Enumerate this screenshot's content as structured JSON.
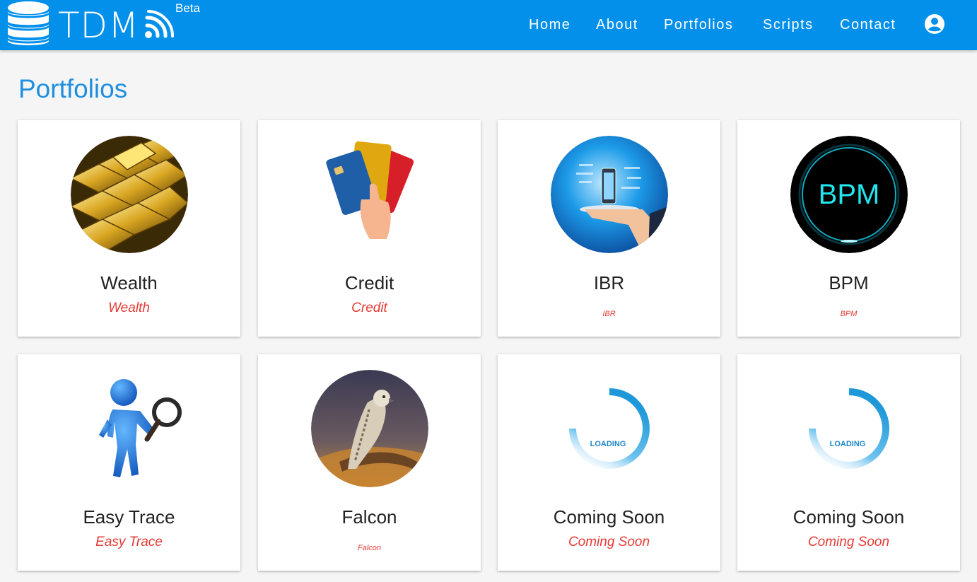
{
  "header": {
    "brand": "TDM",
    "beta": "Beta",
    "nav": [
      {
        "label": "Home"
      },
      {
        "label": "About"
      },
      {
        "label": "Portfolios"
      },
      {
        "label": "Scripts"
      },
      {
        "label": "Contact"
      }
    ],
    "account_icon": "account-circle-icon",
    "color": "#0390ea"
  },
  "page": {
    "title": "Portfolios",
    "title_color": "#1e8fe0"
  },
  "cards": [
    {
      "title": "Wealth",
      "subtitle": "Wealth",
      "image": "gold-bars-image"
    },
    {
      "title": "Credit",
      "subtitle": "Credit",
      "image": "credit-cards-image"
    },
    {
      "title": "IBR",
      "subtitle": "IBR",
      "image": "hand-phone-image"
    },
    {
      "title": "BPM",
      "subtitle": "BPM",
      "image": "bpm-logo-image",
      "image_text": "BPM"
    },
    {
      "title": "Easy Trace",
      "subtitle": "Easy Trace",
      "image": "magnifier-person-image"
    },
    {
      "title": "Falcon",
      "subtitle": "Falcon",
      "image": "falcon-image"
    },
    {
      "title": "Coming Soon",
      "subtitle": "Coming Soon",
      "image": "loading-spinner-image",
      "image_text": "LOADING"
    },
    {
      "title": "Coming Soon",
      "subtitle": "Coming Soon",
      "image": "loading-spinner-image",
      "image_text": "LOADING"
    }
  ],
  "subtitle_color": "#e53935"
}
